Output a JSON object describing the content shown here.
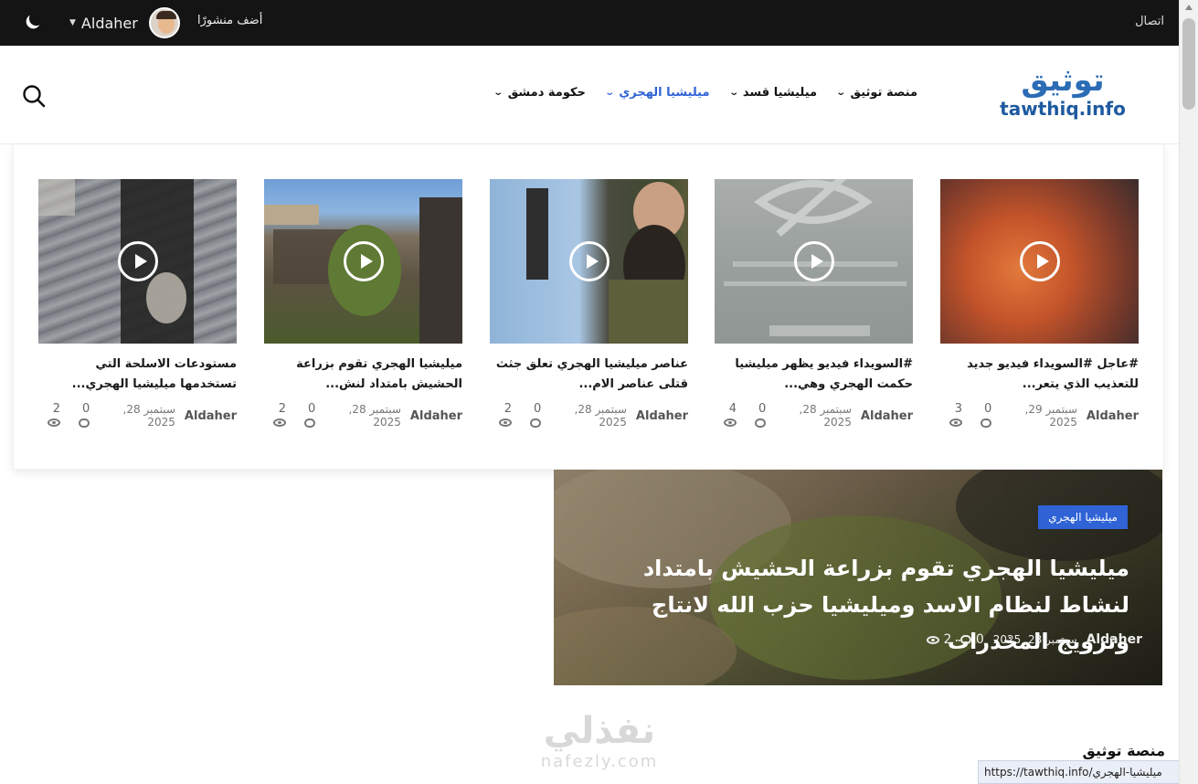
{
  "topbar": {
    "contact": "اتصال",
    "user_name": "Aldaher",
    "add_post": "أضف منشورًا",
    "moon_icon": "moon-icon"
  },
  "logo": {
    "ar": "توثيق",
    "en": "tawthiq.info"
  },
  "nav": {
    "items": [
      {
        "label": "منصة توثيق",
        "active": false
      },
      {
        "label": "ميليشيا قسد",
        "active": false
      },
      {
        "label": "ميليشيا الهجري",
        "active": true
      },
      {
        "label": "حكومة دمشق",
        "active": false
      }
    ],
    "accent": "#2f63d6"
  },
  "mega_cards": [
    {
      "title": "#عاجل #السويداء فيديو جديد للتعذيب الذي يتعر...",
      "author": "Aldaher",
      "date": "سبتمبر 29, 2025",
      "comments": "0",
      "views": "3"
    },
    {
      "title": "#السويداء فيديو يظهر ميليشيا حكمت الهجري وهي...",
      "author": "Aldaher",
      "date": "سبتمبر 28, 2025",
      "comments": "0",
      "views": "4"
    },
    {
      "title": "عناصر ميليشيا الهجري تعلق جثث قتلى عناصر الام...",
      "author": "Aldaher",
      "date": "سبتمبر 28, 2025",
      "comments": "0",
      "views": "2"
    },
    {
      "title": "ميليشيا الهجري تقوم بزراعة الحشيش بامتداد لنش...",
      "author": "Aldaher",
      "date": "سبتمبر 28, 2025",
      "comments": "0",
      "views": "2"
    },
    {
      "title": "مستودعات الاسلحة التي تستخدمها ميليشيا الهجري...",
      "author": "Aldaher",
      "date": "سبتمبر 28, 2025",
      "comments": "0",
      "views": "2"
    }
  ],
  "featured": {
    "badge": "ميليشيا الهجري",
    "headline": "ميليشيا الهجري تقوم بزراعة الحشيش بامتداد لنشاط لنظام الاسد وميليشيا حزب الله لانتاج وترويج المخدرات",
    "author": "Aldaher",
    "date": "سبتمبر 28, 2025",
    "comments": "0",
    "views": "2"
  },
  "watermark": {
    "ar": "نفذلي",
    "en": "nafezly.com"
  },
  "section_title": "منصة توثيق",
  "status_url": "https://tawthiq.info/ميليشيا-الهجري"
}
